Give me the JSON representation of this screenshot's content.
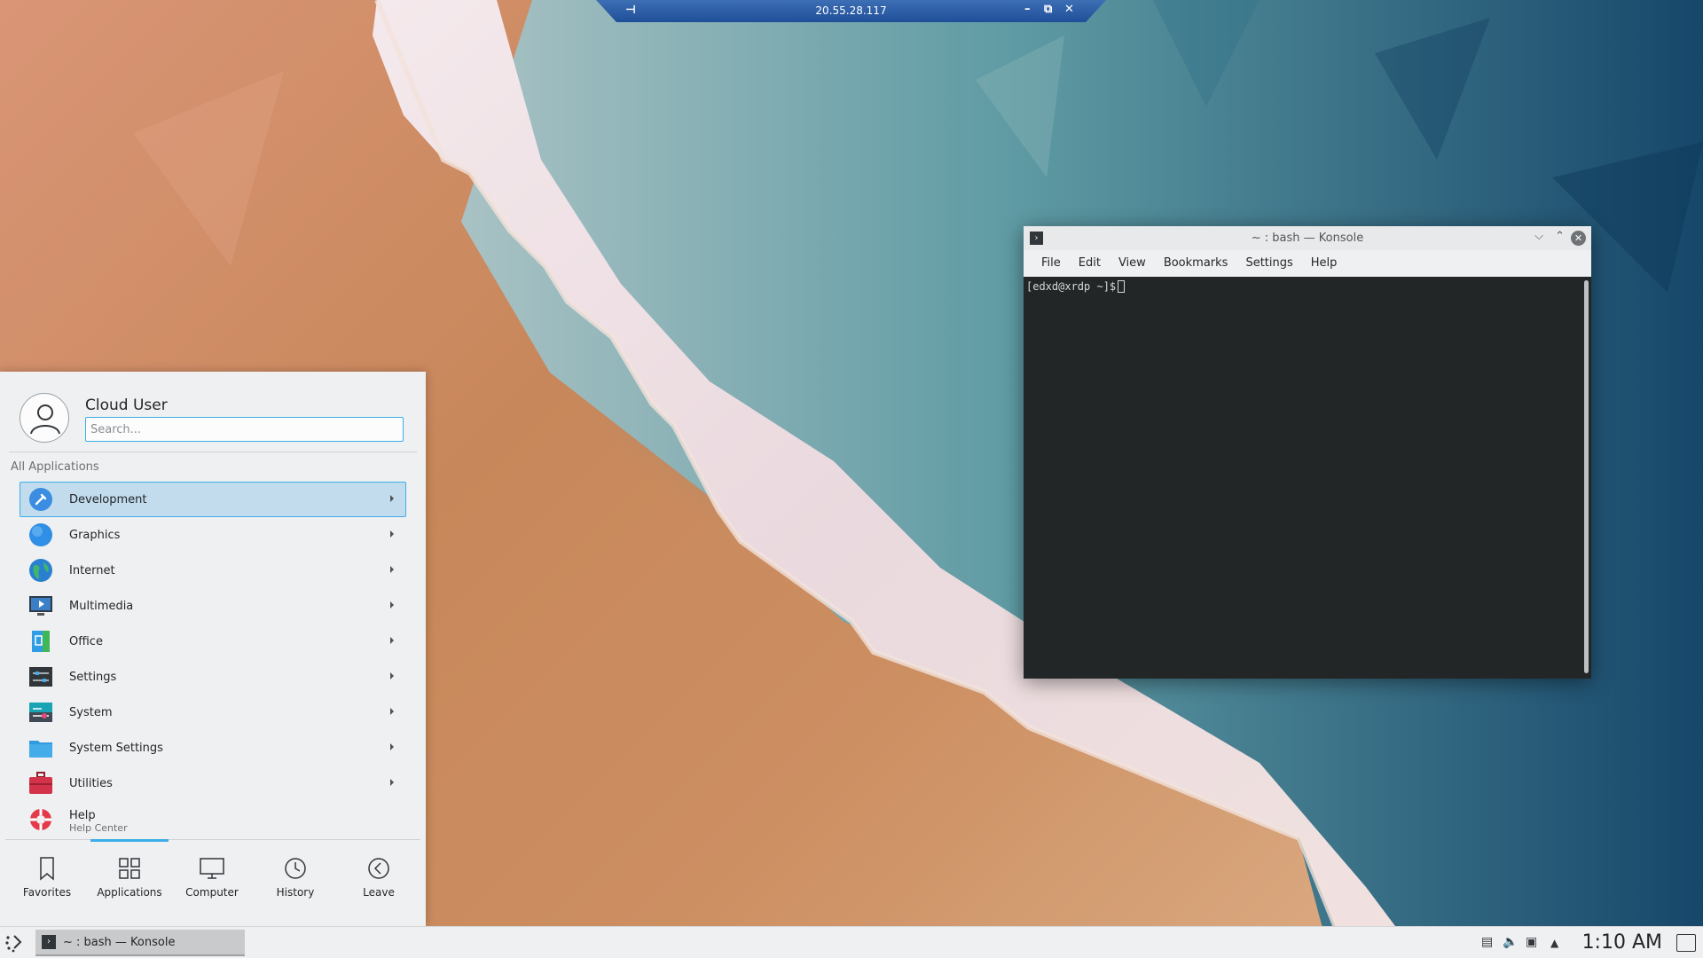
{
  "rdp_bar": {
    "address": "20.55.28.117",
    "pin_icon": "pin-icon",
    "minimize": "–",
    "restore": "⧉",
    "close": "✕"
  },
  "konsole": {
    "title": "~ : bash — Konsole",
    "menu": [
      "File",
      "Edit",
      "View",
      "Bookmarks",
      "Settings",
      "Help"
    ],
    "prompt": "[edxd@xrdp ~]$"
  },
  "launcher": {
    "user_name": "Cloud User",
    "search_placeholder": "Search...",
    "section_label": "All Applications",
    "items": [
      {
        "label": "Development",
        "icon": "development-icon"
      },
      {
        "label": "Graphics",
        "icon": "graphics-icon"
      },
      {
        "label": "Internet",
        "icon": "internet-icon"
      },
      {
        "label": "Multimedia",
        "icon": "multimedia-icon"
      },
      {
        "label": "Office",
        "icon": "office-icon"
      },
      {
        "label": "Settings",
        "icon": "settings-icon"
      },
      {
        "label": "System",
        "icon": "system-icon"
      },
      {
        "label": "System Settings",
        "icon": "system-settings-icon"
      },
      {
        "label": "Utilities",
        "icon": "utilities-icon"
      }
    ],
    "help": {
      "label": "Help",
      "sublabel": "Help Center"
    },
    "tabs": [
      "Favorites",
      "Applications",
      "Computer",
      "History",
      "Leave"
    ],
    "active_tab": "Applications"
  },
  "taskbar": {
    "task_label": "~ : bash — Konsole",
    "clock": "1:10 AM"
  },
  "colors": {
    "accent": "#3daee9",
    "highlight": "#c2dced",
    "terminal_bg": "#232627",
    "panel_bg": "#eff0f1"
  }
}
